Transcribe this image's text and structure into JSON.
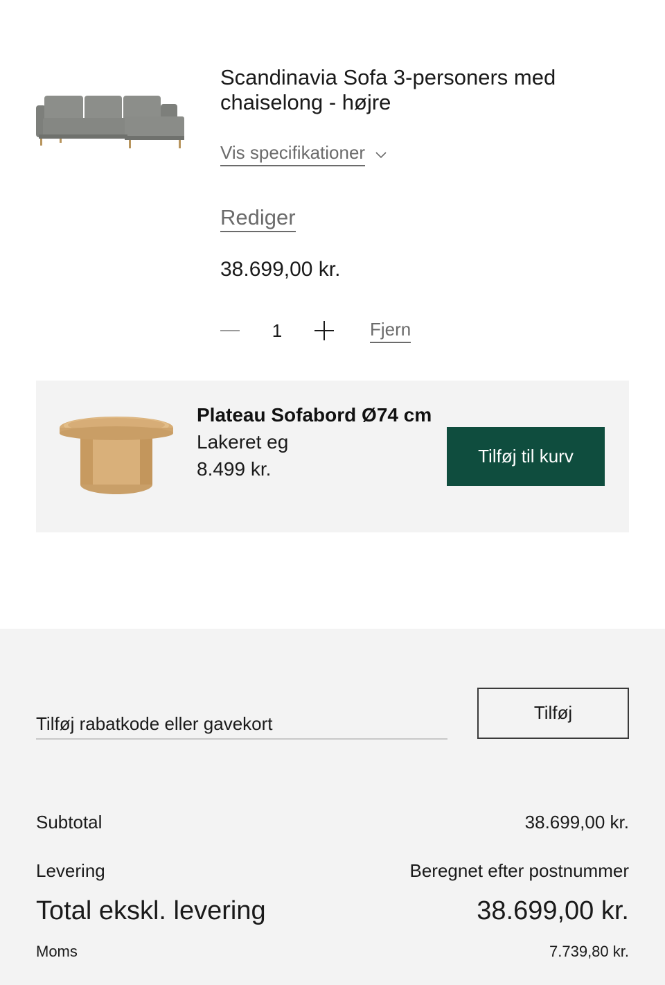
{
  "cart_item": {
    "title": "Scandinavia Sofa 3-personers med chaiselong - højre",
    "spec_label": "Vis specifikationer",
    "edit_label": "Rediger",
    "price": "38.699,00 kr.",
    "quantity": "1",
    "remove_label": "Fjern",
    "image_icon": "sofa-image"
  },
  "upsell": {
    "title": "Plateau Sofabord Ø74 cm",
    "variant": "Lakeret eg",
    "price": "8.499 kr.",
    "button_label": "Tilføj til kurv",
    "button_color": "#0f4d3e",
    "image_icon": "coffee-table-image"
  },
  "discount": {
    "placeholder": "Tilføj rabatkode eller gavekort",
    "value": "",
    "apply_label": "Tilføj"
  },
  "summary": {
    "subtotal_label": "Subtotal",
    "subtotal_value": "38.699,00 kr.",
    "delivery_label": "Levering",
    "delivery_value": "Beregnet efter postnummer",
    "total_label": "Total ekskl. levering",
    "total_value": "38.699,00 kr.",
    "vat_label": "Moms",
    "vat_value": "7.739,80 kr."
  }
}
